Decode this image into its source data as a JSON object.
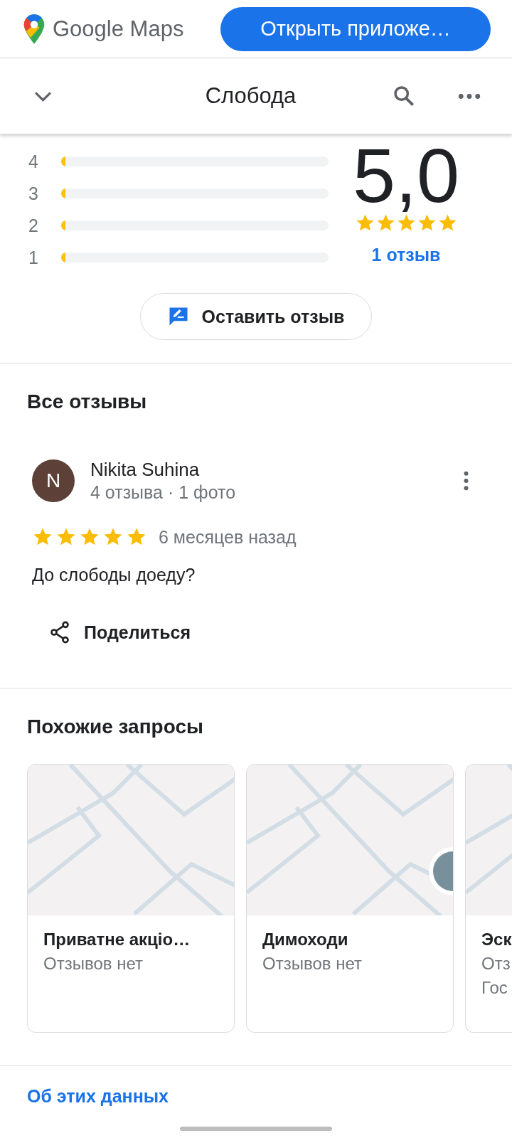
{
  "header": {
    "brand": "Google Maps",
    "open_app_button": "Открыть приложе…"
  },
  "toolbar": {
    "title": "Слобода"
  },
  "rating": {
    "rows": [
      {
        "label": "4",
        "level": 0.01
      },
      {
        "label": "3",
        "level": 0.01
      },
      {
        "label": "2",
        "level": 0.01
      },
      {
        "label": "1",
        "level": 0.01
      }
    ],
    "score": "5,0",
    "stars": 5,
    "count_link": "1 отзыв",
    "write_button": "Оставить отзыв"
  },
  "reviews": {
    "title": "Все отзывы",
    "items": [
      {
        "initial": "N",
        "color": "#5d4037",
        "name": "Nikita Suhina",
        "meta": "4 отзыва · 1 фото",
        "stars": 5,
        "time": "6 месяцев назад",
        "text": "До слободы доеду?",
        "share": "Поделиться"
      }
    ]
  },
  "similar": {
    "title": "Похожие запросы",
    "cards": [
      {
        "kind": "picture",
        "lines": [
          "Приватне акціо…",
          "Отзывов нет"
        ]
      },
      {
        "kind": "picture",
        "pin": true,
        "lines": [
          "Димоходи",
          "Отзывов нет"
        ]
      },
      {
        "kind": "picture",
        "lines": [
          "Эск",
          "Отз",
          "Гос"
        ]
      }
    ]
  },
  "footer_link": "Об этих данных"
}
